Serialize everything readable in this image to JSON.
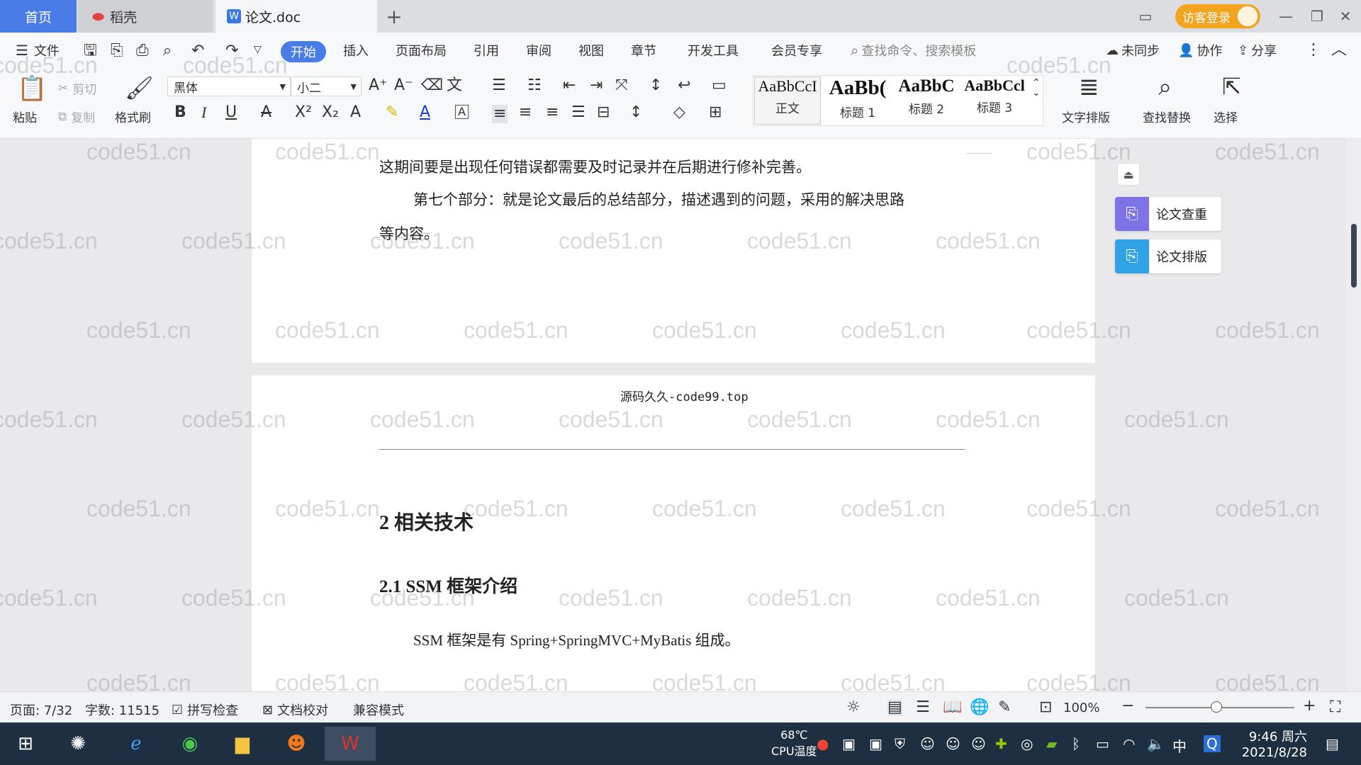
{
  "tabs": {
    "home": "首页",
    "daoke": "稻壳",
    "doc": "论文.doc",
    "new": "+"
  },
  "account": {
    "visitor_login": "访客登录"
  },
  "menu": {
    "file": "文件",
    "items": [
      "开始",
      "插入",
      "页面布局",
      "引用",
      "审阅",
      "视图",
      "章节",
      "开发工具",
      "会员专享"
    ],
    "search_placeholder": "查找命令、搜索模板",
    "sync": "未同步",
    "collab": "协作",
    "share": "分享"
  },
  "toolbar": {
    "paste": "粘贴",
    "cut": "剪切",
    "copy": "复制",
    "format_painter": "格式刷",
    "font": "黑体",
    "size": "小二",
    "styles": [
      {
        "sample": "AaBbCcI",
        "label": "正文"
      },
      {
        "sample": "AaBb(",
        "label": "标题 1"
      },
      {
        "sample": "AaBbC",
        "label": "标题 2"
      },
      {
        "sample": "AaBbCcl",
        "label": "标题 3"
      }
    ],
    "text_layout": "文字排版",
    "find_replace": "查找替换",
    "select": "选择"
  },
  "document": {
    "p1_line1": "这期间要是出现任何错误都需要及时记录并在后期进行修补完善。",
    "p1_line2": "第七个部分：就是论文最后的总结部分，描述遇到的问题，采用的解决思路",
    "p1_line3": "等内容。",
    "header_text": "源码久久-code99.top",
    "heading2": "2  相关技术",
    "heading21": "2.1 SSM 框架介绍",
    "body1": "SSM 框架是有 Spring+SpringMVC+MyBatis 组成。"
  },
  "side_panel": {
    "check": "论文查重",
    "layout": "论文排版"
  },
  "watermark": "code51.cn",
  "status": {
    "page": "页面: 7/32",
    "words": "字数: 11515",
    "spell": "拼写检查",
    "proof": "文档校对",
    "compat": "兼容模式",
    "zoom": "100%"
  },
  "taskbar": {
    "temp": "68℃",
    "cpu": "CPU温度",
    "ime": "中",
    "time": "9:46 周六",
    "date": "2021/8/28"
  },
  "colors": {
    "accent": "#4a7ce8",
    "visitor": "#f2a41f",
    "taskbar": "#1f2f42"
  }
}
